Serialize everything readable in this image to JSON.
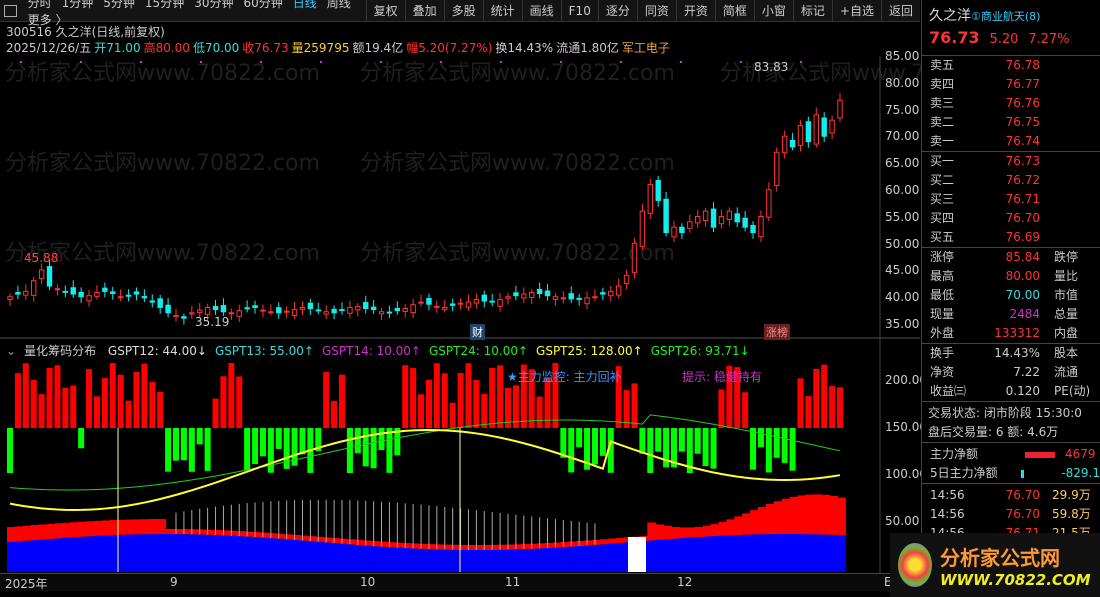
{
  "toolbar": {
    "periods": [
      "分时",
      "1分钟",
      "5分钟",
      "15分钟",
      "30分钟",
      "60分钟",
      "日线",
      "周线",
      "更多 〉"
    ],
    "active": "日线",
    "buttons": [
      "复权",
      "叠加",
      "多股",
      "统计",
      "画线",
      "F10",
      "逐分",
      "同资",
      "开资",
      "简框",
      "小窗",
      "标记",
      "+自选",
      "返回"
    ]
  },
  "header": {
    "title": "300516 久之洋(日线,前复权)",
    "date": "2025/12/26/五",
    "open": "开71.00",
    "high": "高80.00",
    "low": "低70.00",
    "close": "收76.73",
    "vol": "量259795",
    "amount": "额19.4亿",
    "change": "幅5.20(7.27%)",
    "turnover": "换14.43%",
    "float": "流通1.80亿",
    "sector": "军工电子"
  },
  "annotations": {
    "high_mark": "83.83",
    "low_mark": "35.19",
    "left_high": "45.88",
    "event1": "财",
    "event2": "涨榜"
  },
  "y_axis": [
    "85.00",
    "80.00",
    "75.00",
    "70.00",
    "65.00",
    "60.00",
    "55.00",
    "50.00",
    "45.00",
    "40.00",
    "35.00"
  ],
  "ind_axis": [
    "200.00",
    "150.00",
    "100.00",
    "50.00"
  ],
  "x_axis": [
    "2025年",
    "9",
    "10",
    "11",
    "12",
    "E"
  ],
  "indicator": {
    "name": "量化筹码分布",
    "items": [
      {
        "t": "GSPT12: 44.00↓",
        "c": "#ddd"
      },
      {
        "t": "GSPT13: 55.00↑",
        "c": "#3dd"
      },
      {
        "t": "GSPT14: 10.00↑",
        "c": "#c3c"
      },
      {
        "t": "GSPT24: 10.00↑",
        "c": "#2e2"
      },
      {
        "t": "GSPT25: 128.00↑",
        "c": "#ff3"
      },
      {
        "t": "GSPT26: 93.71↓",
        "c": "#2e2"
      }
    ],
    "monitor": "★主力监控:  主力回补",
    "tip": "提示:  稳健持有"
  },
  "watermark": "分析家公式网www.70822.com",
  "quote": {
    "name": "久之洋",
    "tag": "①商业航天(8)",
    "price": "76.73",
    "chg": "5.20",
    "pct": "7.27%",
    "asks": [
      [
        "卖五",
        "76.78"
      ],
      [
        "卖四",
        "76.77"
      ],
      [
        "卖三",
        "76.76"
      ],
      [
        "卖二",
        "76.75"
      ],
      [
        "卖一",
        "76.74"
      ]
    ],
    "bids": [
      [
        "买一",
        "76.73"
      ],
      [
        "买二",
        "76.72"
      ],
      [
        "买三",
        "76.71"
      ],
      [
        "买四",
        "76.70"
      ],
      [
        "买五",
        "76.69"
      ]
    ],
    "stats": [
      [
        "涨停",
        "85.84",
        "跌停"
      ],
      [
        "最高",
        "80.00",
        "量比"
      ],
      [
        "最低",
        "70.00",
        "市值"
      ],
      [
        "现量",
        "2484",
        "总量"
      ],
      [
        "外盘",
        "133312",
        "内盘"
      ]
    ],
    "stats2": [
      [
        "换手",
        "14.43%",
        "股本"
      ],
      [
        "净资",
        "7.22",
        "流通"
      ],
      [
        "收益㈢",
        "0.120",
        "PE(动)"
      ]
    ],
    "status": "交易状态: 闭市阶段 15:30:0",
    "after": "盘后交易量: 6  额: 4.6万",
    "flow": [
      [
        "主力净额",
        "4679"
      ],
      [
        "5日主力净额",
        "-829.1"
      ]
    ],
    "ticks": [
      [
        "14:56",
        "76.70",
        "29.9万"
      ],
      [
        "14:56",
        "76.70",
        "59.8万"
      ],
      [
        "14:56",
        "76.71",
        "21.5万"
      ]
    ]
  },
  "logo": {
    "cn": "分析家公式网",
    "url": "WWW.70822.COM"
  },
  "chart_data": {
    "type": "candlestick",
    "ylim": [
      35,
      85
    ],
    "closes": [
      40,
      40.5,
      41,
      43,
      45,
      42,
      41.5,
      41,
      40.5,
      40,
      40.2,
      40.8,
      41,
      40.6,
      40,
      40.2,
      40.5,
      39.8,
      39,
      38,
      37,
      36.5,
      36,
      37,
      37.5,
      38,
      37.6,
      37.2,
      37,
      37.4,
      37.8,
      38,
      37.5,
      37.2,
      37,
      37.3,
      37.6,
      38,
      37.8,
      37.5,
      37.2,
      37,
      37.5,
      38,
      38.2,
      37.8,
      37.6,
      37.2,
      37,
      37.4,
      37.8,
      38.5,
      39,
      38.6,
      38.2,
      38,
      38.4,
      38.8,
      39,
      39.5,
      39.2,
      39,
      39.5,
      40,
      40.2,
      40.5,
      40.8,
      40.6,
      40.2,
      40,
      39.8,
      39.6,
      39.5,
      39.8,
      40,
      40.5,
      41,
      42,
      44,
      50,
      56,
      61,
      58,
      52,
      53,
      52,
      54,
      55,
      56,
      53,
      55,
      56,
      54,
      53,
      52,
      55,
      60,
      67,
      70,
      68,
      72,
      69,
      74,
      70,
      73,
      76.73
    ]
  }
}
